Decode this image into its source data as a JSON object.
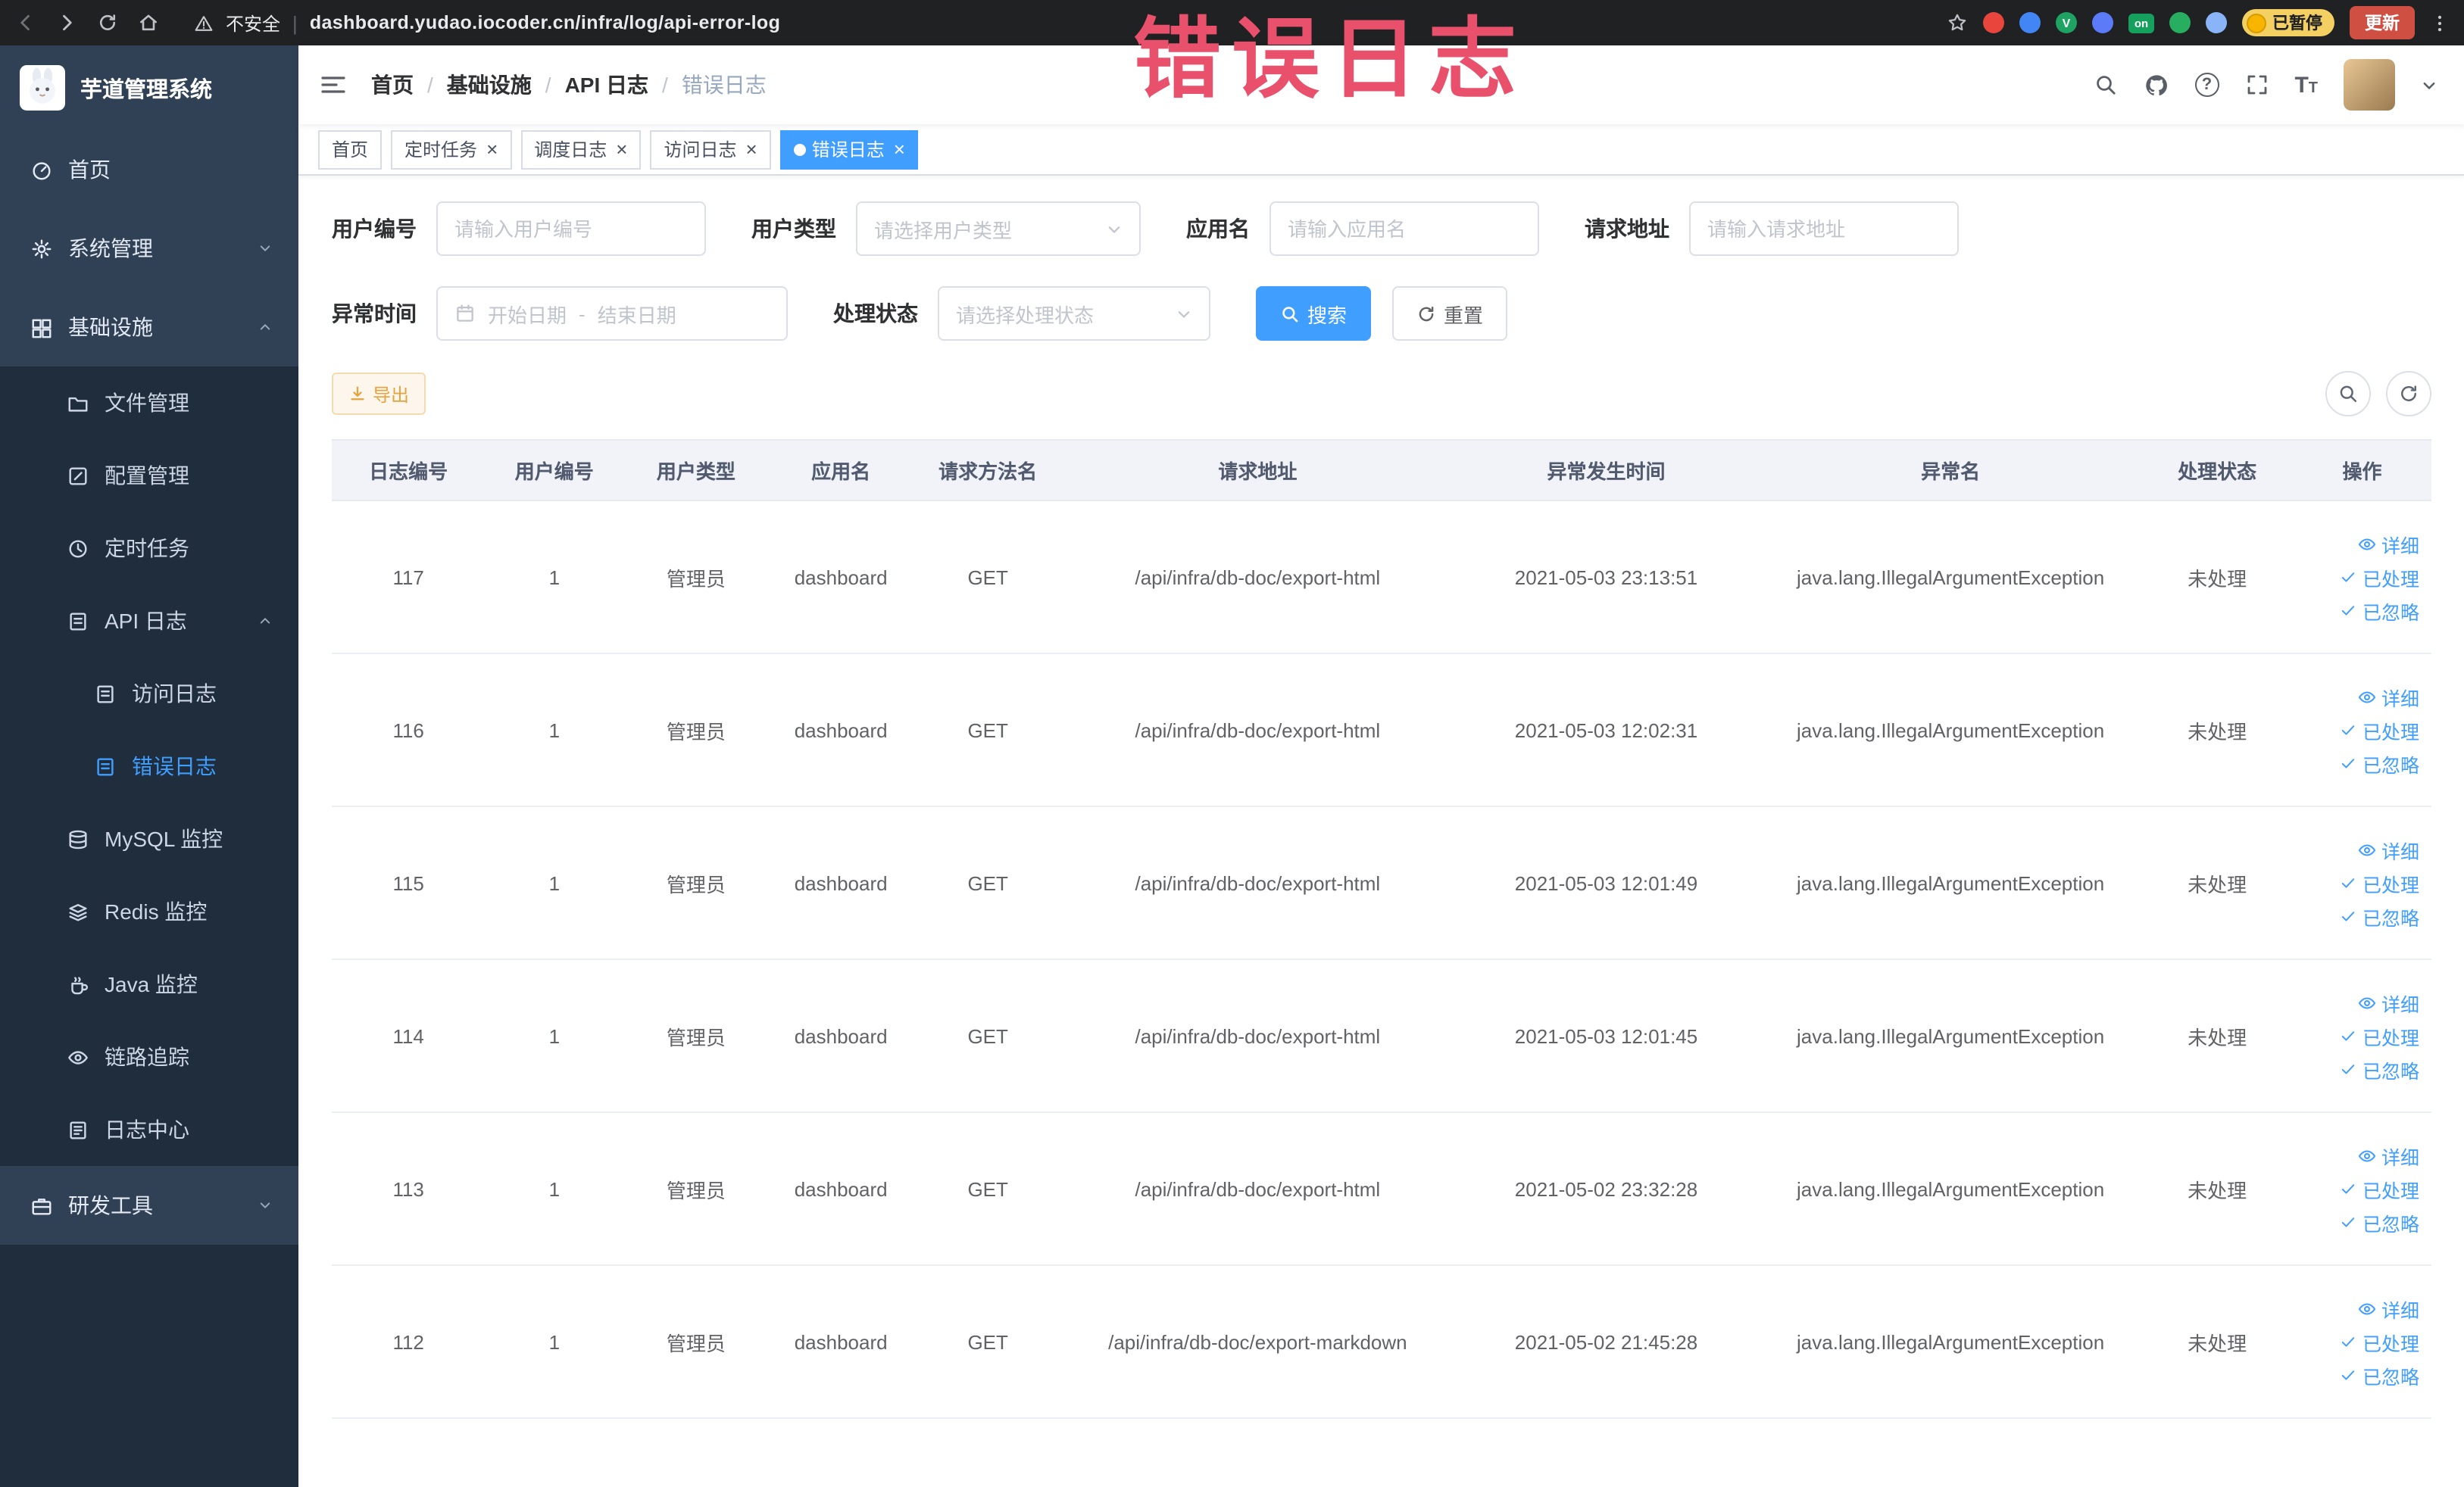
{
  "browser": {
    "security": "不安全",
    "url": "dashboard.yudao.iocoder.cn/infra/log/api-error-log",
    "ext_badge": "on",
    "paused_badge": "已暂停",
    "update_label": "更新",
    "extension_colors": [
      "#e8453c",
      "#4285f4",
      "#1ea362",
      "#5b7bf9",
      "#27ae60",
      "#8ab4f8"
    ]
  },
  "annotation": {
    "text": "错误日志",
    "color": "#e8506b"
  },
  "sidebar": {
    "logo_title": "芋道管理系统",
    "menu": [
      {
        "key": "home",
        "label": "首页",
        "icon": "gauge-icon"
      },
      {
        "key": "system",
        "label": "系统管理",
        "icon": "gear-icon",
        "state": "collapsed",
        "children": []
      },
      {
        "key": "infra",
        "label": "基础设施",
        "icon": "infra-icon",
        "state": "expanded",
        "children": [
          {
            "key": "file",
            "label": "文件管理",
            "icon": "folder-icon"
          },
          {
            "key": "config",
            "label": "配置管理",
            "icon": "edit-square-icon"
          },
          {
            "key": "job",
            "label": "定时任务",
            "icon": "clock-icon"
          },
          {
            "key": "api-log",
            "label": "API 日志",
            "icon": "doc-edit-icon",
            "state": "expanded",
            "children": [
              {
                "key": "access-log",
                "label": "访问日志",
                "icon": "doc-edit-icon"
              },
              {
                "key": "error-log",
                "label": "错误日志",
                "icon": "doc-edit-icon",
                "active": true
              }
            ]
          },
          {
            "key": "mysql",
            "label": "MySQL 监控",
            "icon": "db-icon"
          },
          {
            "key": "redis",
            "label": "Redis 监控",
            "icon": "redis-icon"
          },
          {
            "key": "java",
            "label": "Java 监控",
            "icon": "java-icon"
          },
          {
            "key": "trace",
            "label": "链路追踪",
            "icon": "eye-icon"
          },
          {
            "key": "log-center",
            "label": "日志中心",
            "icon": "log-icon"
          }
        ]
      },
      {
        "key": "devtools",
        "label": "研发工具",
        "icon": "tool-icon",
        "state": "collapsed",
        "children": []
      }
    ]
  },
  "header": {
    "breadcrumb": [
      "首页",
      "基础设施",
      "API 日志",
      "错误日志"
    ]
  },
  "tabs": [
    {
      "key": "home",
      "label": "首页",
      "closable": false,
      "active": false
    },
    {
      "key": "job",
      "label": "定时任务",
      "closable": true,
      "active": false
    },
    {
      "key": "job-log",
      "label": "调度日志",
      "closable": true,
      "active": false
    },
    {
      "key": "access-log",
      "label": "访问日志",
      "closable": true,
      "active": false
    },
    {
      "key": "error-log",
      "label": "错误日志",
      "closable": true,
      "active": true
    }
  ],
  "filters": {
    "fields": [
      {
        "label": "用户编号",
        "placeholder": "请输入用户编号",
        "type": "input"
      },
      {
        "label": "用户类型",
        "placeholder": "请选择用户类型",
        "type": "select"
      },
      {
        "label": "应用名",
        "placeholder": "请输入应用名",
        "type": "input"
      },
      {
        "label": "请求地址",
        "placeholder": "请输入请求地址",
        "type": "input"
      },
      {
        "label": "异常时间",
        "type": "daterange",
        "start_placeholder": "开始日期",
        "end_placeholder": "结束日期",
        "separator": "-"
      },
      {
        "label": "处理状态",
        "placeholder": "请选择处理状态",
        "type": "select"
      }
    ],
    "search_label": "搜索",
    "reset_label": "重置"
  },
  "toolbar": {
    "export_label": "导出"
  },
  "table": {
    "columns": [
      "日志编号",
      "用户编号",
      "用户类型",
      "应用名",
      "请求方法名",
      "请求地址",
      "异常发生时间",
      "异常名",
      "处理状态",
      "操作"
    ],
    "row_actions": [
      "详细",
      "已处理",
      "已忽略"
    ],
    "rows": [
      {
        "id": "117",
        "user_id": "1",
        "user_type": "管理员",
        "app": "dashboard",
        "method": "GET",
        "url": "/api/infra/db-doc/export-html",
        "time": "2021-05-03 23:13:51",
        "exception": "java.lang.IllegalArgumentException",
        "status": "未处理"
      },
      {
        "id": "116",
        "user_id": "1",
        "user_type": "管理员",
        "app": "dashboard",
        "method": "GET",
        "url": "/api/infra/db-doc/export-html",
        "time": "2021-05-03 12:02:31",
        "exception": "java.lang.IllegalArgumentException",
        "status": "未处理"
      },
      {
        "id": "115",
        "user_id": "1",
        "user_type": "管理员",
        "app": "dashboard",
        "method": "GET",
        "url": "/api/infra/db-doc/export-html",
        "time": "2021-05-03 12:01:49",
        "exception": "java.lang.IllegalArgumentException",
        "status": "未处理"
      },
      {
        "id": "114",
        "user_id": "1",
        "user_type": "管理员",
        "app": "dashboard",
        "method": "GET",
        "url": "/api/infra/db-doc/export-html",
        "time": "2021-05-03 12:01:45",
        "exception": "java.lang.IllegalArgumentException",
        "status": "未处理"
      },
      {
        "id": "113",
        "user_id": "1",
        "user_type": "管理员",
        "app": "dashboard",
        "method": "GET",
        "url": "/api/infra/db-doc/export-html",
        "time": "2021-05-02 23:32:28",
        "exception": "java.lang.IllegalArgumentException",
        "status": "未处理"
      },
      {
        "id": "112",
        "user_id": "1",
        "user_type": "管理员",
        "app": "dashboard",
        "method": "GET",
        "url": "/api/infra/db-doc/export-markdown",
        "time": "2021-05-02 21:45:28",
        "exception": "java.lang.IllegalArgumentException",
        "status": "未处理"
      }
    ]
  }
}
